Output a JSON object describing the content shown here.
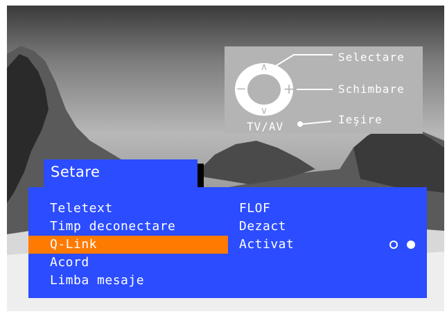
{
  "help": {
    "select_label": "Selectare",
    "change_label": "Schimbare",
    "exit_label": "Ieşire",
    "source_label": "TV/AV"
  },
  "menu": {
    "title": "Setare",
    "items": [
      {
        "label": "Teletext"
      },
      {
        "label": "Timp deconectare"
      },
      {
        "label": "Q-Link",
        "selected": true
      },
      {
        "label": "Acord"
      },
      {
        "label": "Limba mesaje"
      }
    ],
    "values": [
      {
        "text": "FLOF"
      },
      {
        "text": "Dezact"
      },
      {
        "text": "Activat"
      }
    ],
    "qlink_state": "on"
  },
  "colors": {
    "menu_blue": "#2b4cff",
    "highlight_orange": "#ff7a00",
    "help_grey": "#b4b4b4"
  }
}
